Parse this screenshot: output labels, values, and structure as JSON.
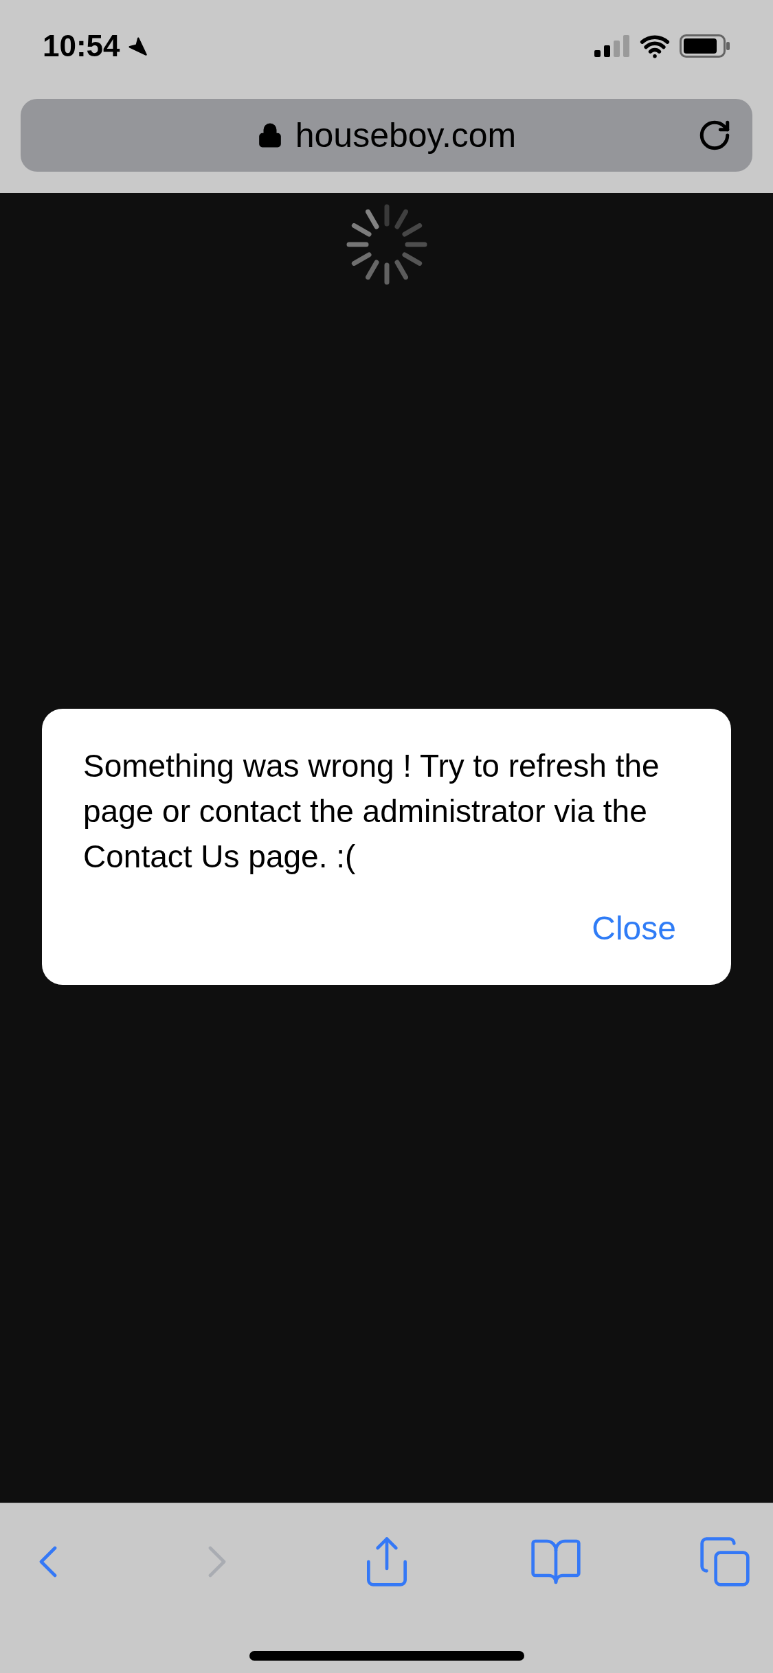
{
  "status_bar": {
    "time": "10:54"
  },
  "address_bar": {
    "url": "houseboy.com",
    "secure": true
  },
  "page": {
    "loading": true
  },
  "dialog": {
    "message": "Something was wrong ! Try to refresh the page or contact the administrator via the Contact Us page. :(",
    "button": "Close"
  },
  "toolbar": [
    {
      "kind": "back",
      "disabled": false
    },
    {
      "kind": "forward",
      "disabled": true
    },
    {
      "kind": "share",
      "disabled": false
    },
    {
      "kind": "bookmarks",
      "disabled": false
    },
    {
      "kind": "tabs",
      "disabled": false
    }
  ]
}
